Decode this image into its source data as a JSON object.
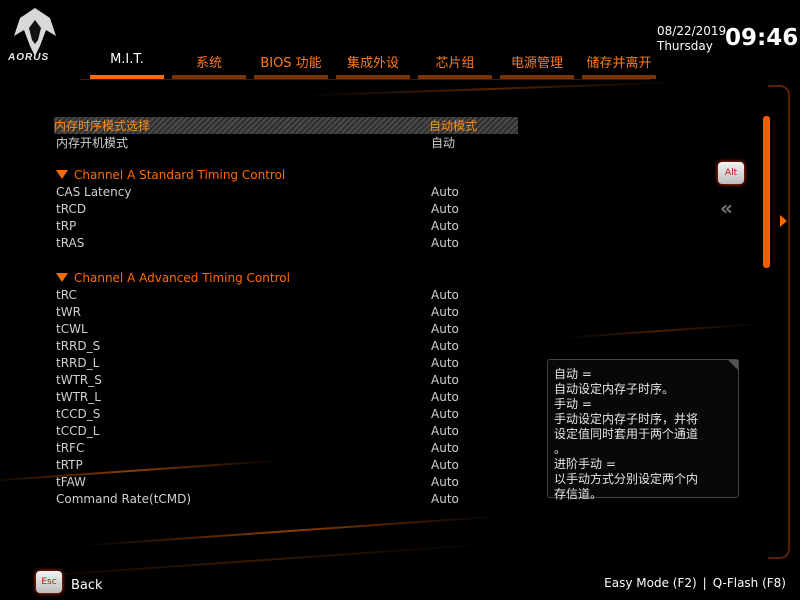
{
  "brand": {
    "logo_text": "AORUS"
  },
  "tabs": [
    {
      "label": "M.I.T.",
      "active": true
    },
    {
      "label": "系统"
    },
    {
      "label": "BIOS 功能"
    },
    {
      "label": "集成外设"
    },
    {
      "label": "芯片组"
    },
    {
      "label": "电源管理"
    },
    {
      "label": "储存并离开"
    }
  ],
  "clock": {
    "date": "08/22/2019",
    "day": "Thursday",
    "time": "09:46"
  },
  "settings": {
    "memory_timing_mode": {
      "label": "内存时序模式选择",
      "value": "自动模式"
    },
    "memory_boot_mode": {
      "label": "内存开机模式",
      "value": "自动"
    },
    "section_standard": "Channel A Standard Timing Control",
    "standard": [
      {
        "label": "CAS Latency",
        "value": "Auto"
      },
      {
        "label": "tRCD",
        "value": "Auto"
      },
      {
        "label": "tRP",
        "value": "Auto"
      },
      {
        "label": "tRAS",
        "value": "Auto"
      }
    ],
    "section_advanced": "Channel A Advanced Timing Control",
    "advanced": [
      {
        "label": "tRC",
        "value": "Auto"
      },
      {
        "label": "tWR",
        "value": "Auto"
      },
      {
        "label": "tCWL",
        "value": "Auto"
      },
      {
        "label": "tRRD_S",
        "value": "Auto"
      },
      {
        "label": "tRRD_L",
        "value": "Auto"
      },
      {
        "label": "tWTR_S",
        "value": "Auto"
      },
      {
        "label": "tWTR_L",
        "value": "Auto"
      },
      {
        "label": "tCCD_S",
        "value": "Auto"
      },
      {
        "label": "tCCD_L",
        "value": "Auto"
      },
      {
        "label": "tRFC",
        "value": "Auto"
      },
      {
        "label": "tRTP",
        "value": "Auto"
      },
      {
        "label": "tFAW",
        "value": "Auto"
      },
      {
        "label": "Command Rate(tCMD)",
        "value": "Auto"
      }
    ]
  },
  "keys": {
    "alt": "Alt",
    "esc": "Esc"
  },
  "help": {
    "lines": [
      "自动 =",
      "自动设定内存子时序。",
      "手动 =",
      "手动设定内存子时序，并将",
      "设定值同时套用于两个通道",
      "。",
      "进阶手动 =",
      "以手动方式分别设定两个内",
      "存信道。"
    ]
  },
  "footer": {
    "back_label": "Back",
    "easy_mode": "Easy Mode (F2)",
    "divider": "|",
    "qflash": "Q-Flash (F8)"
  },
  "colors": {
    "accent": "#ff6a00",
    "background": "#000000"
  },
  "icons": {
    "logo": "aorus-eagle-icon",
    "collapse": "triangle-down-icon",
    "back_chevrons": "double-chevron-left-icon"
  }
}
